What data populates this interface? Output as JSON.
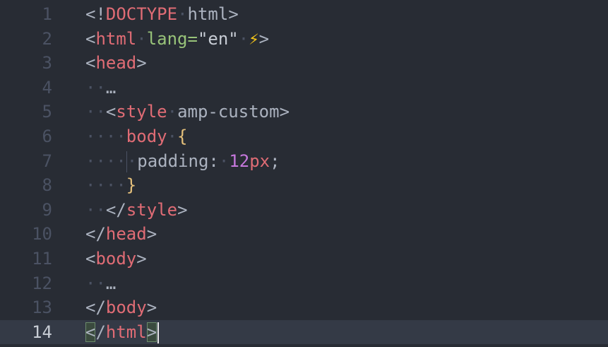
{
  "editor": {
    "lines": [
      {
        "num": "1",
        "tokens": [
          {
            "t": "<!",
            "c": "punc"
          },
          {
            "t": "DOCTYPE",
            "c": "tag"
          },
          {
            "t": "·",
            "c": "ws"
          },
          {
            "t": "html",
            "c": "punc"
          },
          {
            "t": ">",
            "c": "punc"
          }
        ]
      },
      {
        "num": "2",
        "tokens": [
          {
            "t": "<",
            "c": "punc"
          },
          {
            "t": "html",
            "c": "tag"
          },
          {
            "t": "·",
            "c": "ws"
          },
          {
            "t": "lang",
            "c": "attr"
          },
          {
            "t": "=",
            "c": "attr"
          },
          {
            "t": "\"en\"",
            "c": "str"
          },
          {
            "t": "·",
            "c": "ws"
          },
          {
            "t": "⚡",
            "c": "emoji"
          },
          {
            "t": ">",
            "c": "punc"
          }
        ]
      },
      {
        "num": "3",
        "tokens": [
          {
            "t": "<",
            "c": "punc"
          },
          {
            "t": "head",
            "c": "tag"
          },
          {
            "t": ">",
            "c": "punc"
          }
        ]
      },
      {
        "num": "4",
        "tokens": [
          {
            "t": "··",
            "c": "ws"
          },
          {
            "t": "…",
            "c": "punc"
          }
        ]
      },
      {
        "num": "5",
        "tokens": [
          {
            "t": "··",
            "c": "ws"
          },
          {
            "t": "<",
            "c": "punc"
          },
          {
            "t": "style",
            "c": "tag"
          },
          {
            "t": "·",
            "c": "ws"
          },
          {
            "t": "amp-custom",
            "c": "punc"
          },
          {
            "t": ">",
            "c": "punc"
          }
        ]
      },
      {
        "num": "6",
        "tokens": [
          {
            "t": "····",
            "c": "ws"
          },
          {
            "t": "body",
            "c": "tag"
          },
          {
            "t": "·",
            "c": "ws"
          },
          {
            "t": "{",
            "c": "brace"
          }
        ]
      },
      {
        "num": "7",
        "tokens": [
          {
            "t": "····",
            "c": "ws"
          },
          {
            "t": "GUIDE",
            "c": "guide"
          },
          {
            "t": "·",
            "c": "ws"
          },
          {
            "t": "padding",
            "c": "punc"
          },
          {
            "t": ":",
            "c": "punc"
          },
          {
            "t": "·",
            "c": "ws"
          },
          {
            "t": "12",
            "c": "kw"
          },
          {
            "t": "px",
            "c": "tag"
          },
          {
            "t": ";",
            "c": "punc"
          }
        ]
      },
      {
        "num": "8",
        "tokens": [
          {
            "t": "····",
            "c": "ws"
          },
          {
            "t": "}",
            "c": "brace"
          }
        ]
      },
      {
        "num": "9",
        "tokens": [
          {
            "t": "··",
            "c": "ws"
          },
          {
            "t": "</",
            "c": "punc"
          },
          {
            "t": "style",
            "c": "tag"
          },
          {
            "t": ">",
            "c": "punc"
          }
        ]
      },
      {
        "num": "10",
        "tokens": [
          {
            "t": "</",
            "c": "punc"
          },
          {
            "t": "head",
            "c": "tag"
          },
          {
            "t": ">",
            "c": "punc"
          }
        ]
      },
      {
        "num": "11",
        "tokens": [
          {
            "t": "<",
            "c": "punc"
          },
          {
            "t": "body",
            "c": "tag"
          },
          {
            "t": ">",
            "c": "punc"
          }
        ]
      },
      {
        "num": "12",
        "tokens": [
          {
            "t": "··",
            "c": "ws"
          },
          {
            "t": "…",
            "c": "punc"
          }
        ]
      },
      {
        "num": "13",
        "tokens": [
          {
            "t": "</",
            "c": "punc"
          },
          {
            "t": "body",
            "c": "tag"
          },
          {
            "t": ">",
            "c": "punc"
          }
        ]
      },
      {
        "num": "14",
        "active": true,
        "tokens": [
          {
            "t": "<",
            "c": "punc match"
          },
          {
            "t": "/",
            "c": "punc"
          },
          {
            "t": "html",
            "c": "tag"
          },
          {
            "t": ">",
            "c": "punc match"
          },
          {
            "t": "CURSOR",
            "c": "cursor"
          }
        ]
      }
    ]
  }
}
